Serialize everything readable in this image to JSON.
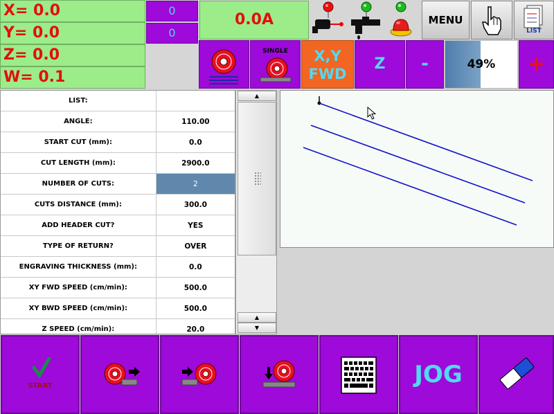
{
  "coords": {
    "x": "X= 0.0",
    "y": "Y= 0.0",
    "z": "Z= 0.0",
    "w": "W= 0.1",
    "x_small": "0",
    "y_small": "0"
  },
  "current": "0.0A",
  "toolbar": {
    "menu_label": "MENU",
    "list_label": "LIST",
    "single_label": "SINGLE",
    "xy_fwd_line1": "X,Y",
    "xy_fwd_line2": "FWD",
    "z_label": "Z",
    "minus_label": "-",
    "plus_label": "+",
    "speed_percent": "49%",
    "speed_fraction": 0.49
  },
  "table": {
    "rows": [
      {
        "label": "LIST:",
        "value": ""
      },
      {
        "label": "ANGLE:",
        "value": "110.00"
      },
      {
        "label": "START CUT (mm):",
        "value": "0.0"
      },
      {
        "label": "CUT LENGTH (mm):",
        "value": "2900.0"
      },
      {
        "label": "NUMBER OF CUTS:",
        "value": "2",
        "selected": true
      },
      {
        "label": "CUTS DISTANCE (mm):",
        "value": "300.0"
      },
      {
        "label": "ADD HEADER CUT?",
        "value": "YES"
      },
      {
        "label": "TYPE OF RETURN?",
        "value": "OVER"
      },
      {
        "label": "ENGRAVING THICKNESS (mm):",
        "value": "0.0"
      },
      {
        "label": "XY FWD SPEED (cm/min):",
        "value": "500.0"
      },
      {
        "label": "XY BWD SPEED (cm/min):",
        "value": "500.0"
      },
      {
        "label": "Z SPEED (cm/min):",
        "value": "20.0"
      }
    ]
  },
  "bottom": {
    "start_label": "START",
    "jog_label": "JOG"
  },
  "colors": {
    "purple": "#9d0ad9",
    "green": "#9cec8a",
    "red_text": "#e01010",
    "cyan_text": "#52d9f2",
    "orange": "#f26522",
    "line_blue": "#1010cc"
  },
  "icons": [
    "red-light-icon",
    "green-light-icon",
    "laser-pointer-icon",
    "water-tap-icon",
    "emergency-stop-icon",
    "hand-pointer-icon",
    "list-icon",
    "saw-blade-icon",
    "single-cut-icon",
    "start-check-icon",
    "blade-forward-icon",
    "blade-backward-icon",
    "blade-down-icon",
    "keyboard-icon",
    "eraser-icon"
  ]
}
